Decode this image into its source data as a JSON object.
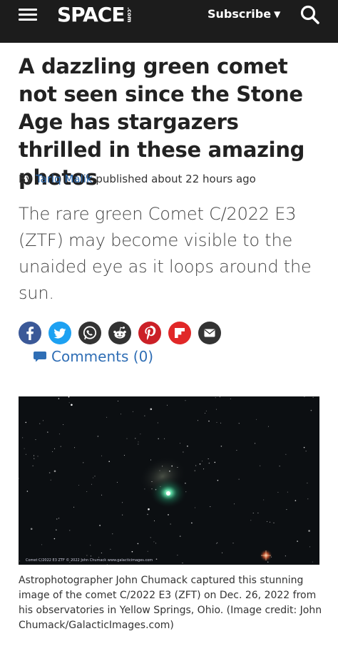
{
  "header": {
    "logo_text": "SPACE",
    "logo_tld": ".com",
    "subscribe_label": "Subscribe",
    "icons": {
      "menu": "hamburger-menu-icon",
      "caret": "caret-down-icon",
      "search": "search-icon"
    },
    "background": "#1c1c1c"
  },
  "article": {
    "headline": "A dazzling green comet not seen since the Stone Age has stargazers thrilled in these amazing photos",
    "byline_prefix": "By",
    "author": "Tariq Malik",
    "published": "published about 22 hours ago",
    "standfirst": "The rare green Comet C/2022 E3 (ZTF) may become visible to the unaided eye as it loops around the sun."
  },
  "share": {
    "buttons": [
      {
        "name": "facebook",
        "color": "#3b5998"
      },
      {
        "name": "twitter",
        "color": "#1da1f2"
      },
      {
        "name": "whatsapp",
        "color": "#333333"
      },
      {
        "name": "reddit",
        "color": "#333333"
      },
      {
        "name": "pinterest",
        "color": "#cb2027"
      },
      {
        "name": "flipboard",
        "color": "#e12828"
      },
      {
        "name": "email",
        "color": "#333333"
      }
    ],
    "comments_label": "Comments (0)"
  },
  "figure": {
    "image_small_text": "Comet C/2022 E3 ZTF  © 2022 John Chumack www.galacticimages.com",
    "caption": "Astrophotographer John Chumack captured this stunning image of the comet C/2022 E3 (ZFT) on Dec. 26, 2022 from his observatories in Yellow Springs, Ohio. (Image credit: John Chumack/GalacticImages.com)"
  },
  "colors": {
    "link": "#2f6eb5",
    "text": "#222222"
  }
}
